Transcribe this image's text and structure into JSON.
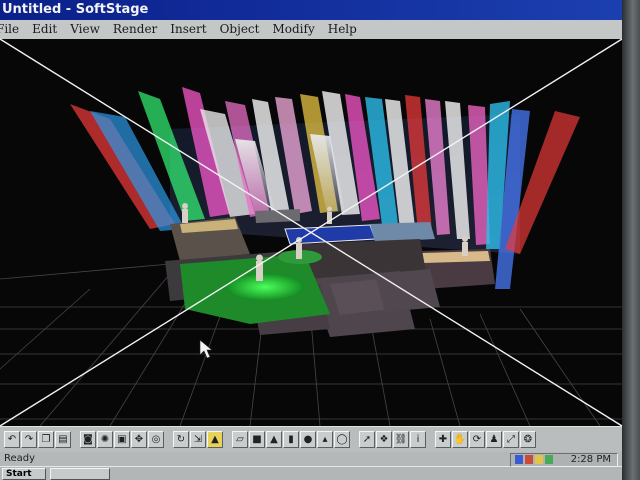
{
  "window": {
    "title": "Untitled - SoftStage"
  },
  "menu": [
    "File",
    "Edit",
    "View",
    "Render",
    "Insert",
    "Object",
    "Modify",
    "Help"
  ],
  "status": {
    "text": "Ready"
  },
  "taskbar": {
    "start_label": "Start",
    "task_label": "",
    "clock": "2:28 PM"
  },
  "toolbar": {
    "groups": [
      [
        "undo-icon",
        "redo-icon",
        "copy-icon",
        "paste-icon"
      ],
      [
        "camera-icon",
        "light-icon",
        "select-icon",
        "move-icon",
        "target-icon"
      ],
      [
        "rotate-icon",
        "scale-icon",
        "spotlight-icon"
      ],
      [
        "plane-icon",
        "cube-icon",
        "pyramid-icon",
        "cylinder-icon",
        "sphere-icon",
        "cone-icon",
        "torus-icon"
      ],
      [
        "pointer-icon",
        "group-icon",
        "link-icon",
        "info-icon"
      ],
      [
        "zoom-icon",
        "pan-icon",
        "orbit-icon",
        "walk-icon",
        "fit-icon",
        "render-icon"
      ]
    ],
    "active": "spotlight-icon"
  },
  "colors": {
    "titlebar": "#0a1f8a",
    "beams": [
      "#ff3d3d",
      "#2fd0ff",
      "#36ff7a",
      "#ff5ad2",
      "#ffffff",
      "#ffd84a",
      "#4a7dff",
      "#ff8a2a",
      "#c06bff"
    ]
  }
}
